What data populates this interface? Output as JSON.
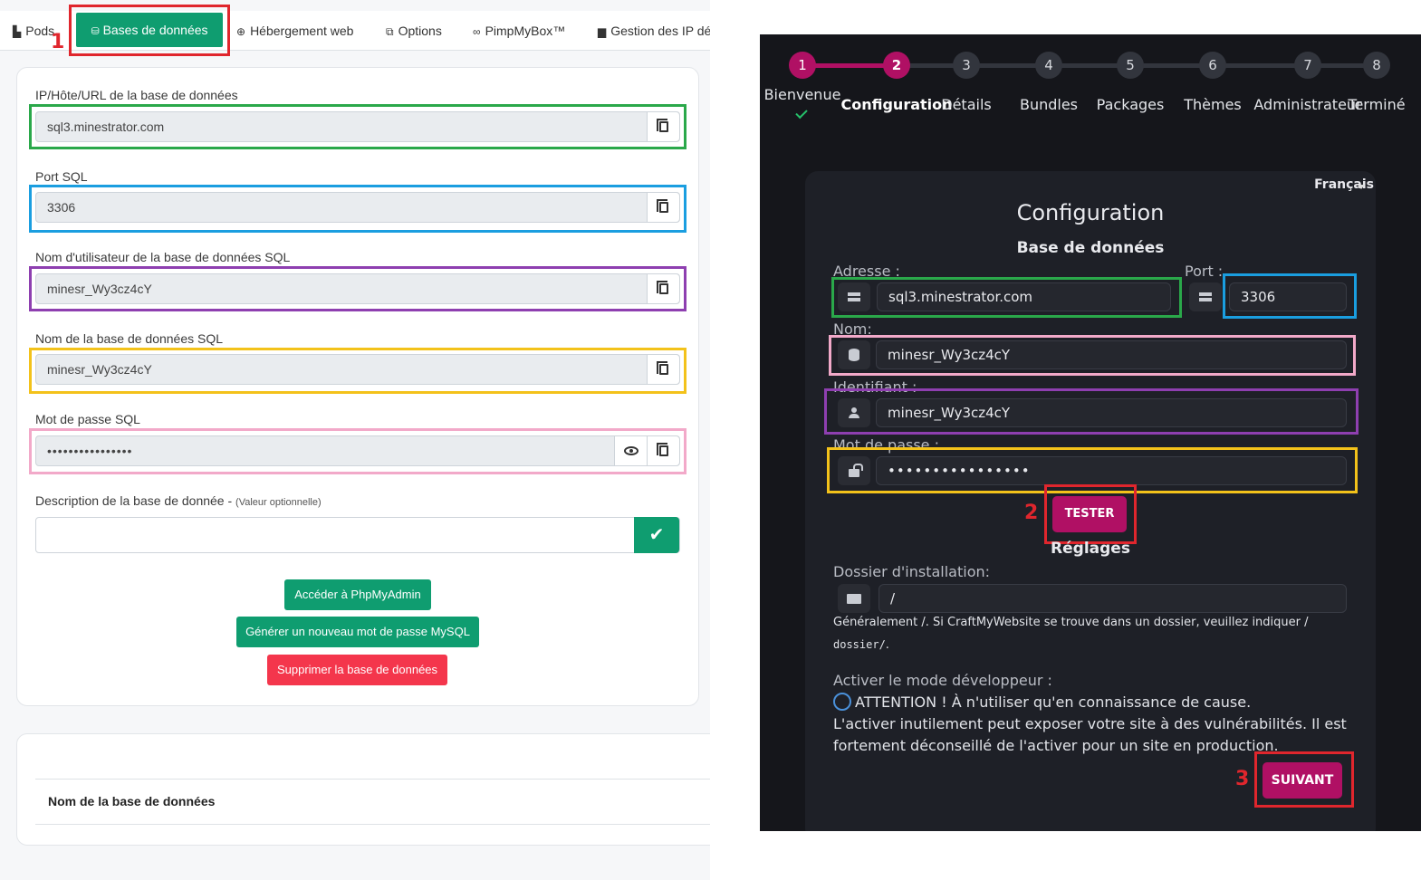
{
  "left": {
    "nav": [
      {
        "label": "Pods",
        "icon": "pods-icon"
      },
      {
        "label": "Bases de données",
        "icon": "database-icon",
        "active": true
      },
      {
        "label": "Hébergement web",
        "icon": "globe-icon"
      },
      {
        "label": "Options",
        "icon": "options-icon"
      },
      {
        "label": "PimpMyBox™",
        "icon": "mask-icon"
      },
      {
        "label": "Gestion des IP dé",
        "icon": "monitor-icon"
      }
    ],
    "annotation_1": "1",
    "fields": [
      {
        "label": "IP/Hôte/URL de la base de données",
        "value": "sql3.minestrator.com"
      },
      {
        "label": "Port SQL",
        "value": "3306"
      },
      {
        "label": "Nom d'utilisateur de la base de données SQL",
        "value": "minesr_Wy3cz4cY"
      },
      {
        "label": "Nom de la base de données SQL",
        "value": "minesr_Wy3cz4cY"
      },
      {
        "label": "Mot de passe SQL",
        "value": "••••••••••••••••"
      }
    ],
    "description_label": "Description de la base de donnée - ",
    "description_hint": "(Valeur optionnelle)",
    "buttons": {
      "phpmyadmin": "Accéder à PhpMyAdmin",
      "new_password": "Générer un nouveau mot de passe MySQL",
      "delete": "Supprimer la base de données"
    },
    "table_header": "Nom de la base de données",
    "colors": {
      "accent": "#0f9d70",
      "danger": "#f4364c"
    }
  },
  "right": {
    "steps": [
      {
        "num": "1",
        "label": "Bienvenue",
        "state": "done"
      },
      {
        "num": "2",
        "label": "Configuration",
        "state": "current"
      },
      {
        "num": "3",
        "label": "Détails",
        "state": "todo"
      },
      {
        "num": "4",
        "label": "Bundles",
        "state": "todo"
      },
      {
        "num": "5",
        "label": "Packages",
        "state": "todo"
      },
      {
        "num": "6",
        "label": "Thèmes",
        "state": "todo"
      },
      {
        "num": "7",
        "label": "Administrateur",
        "state": "todo"
      },
      {
        "num": "8",
        "label": "Terminé",
        "state": "todo"
      }
    ],
    "language": "Français",
    "title": "Configuration",
    "subtitle": "Base de données",
    "address_label": "Adresse :",
    "address_value": "sql3.minestrator.com",
    "port_label": "Port :",
    "port_value": "3306",
    "name_label": "Nom:",
    "name_value": "minesr_Wy3cz4cY",
    "id_label": "Identifiant :",
    "id_value": "minesr_Wy3cz4cY",
    "password_label": "Mot de passe :",
    "password_value": "••••••••••••••••",
    "test_button": "TESTER",
    "annotation_2": "2",
    "settings_title": "Réglages",
    "install_label": "Dossier d'installation:",
    "install_value": "/",
    "install_hint_a": "Généralement /. Si CraftMyWebsite se trouve dans un dossier, veuillez indiquer /",
    "install_hint_b": "dossier/",
    "install_hint_c": ".",
    "dev_label": "Activer le mode développeur :",
    "dev_warning": "ATTENTION ! À n'utiliser qu'en connaissance de cause.",
    "dev_text": "L'activer inutilement peut exposer votre site à des vulnérabilités. Il est fortement déconseillé de l'activer pour un site en production.",
    "next_button": "SUIVANT",
    "annotation_3": "3",
    "colors": {
      "accent": "#b01064",
      "background": "#15161b"
    }
  }
}
